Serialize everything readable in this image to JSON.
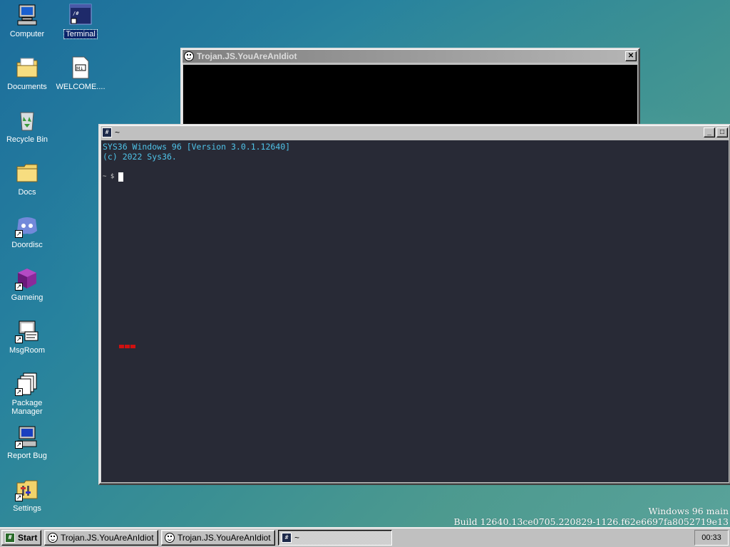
{
  "desktop": {
    "icons": [
      {
        "label": "Computer",
        "icon": "computer-icon"
      },
      {
        "label": "Terminal",
        "icon": "terminal-icon"
      },
      {
        "label": "Documents",
        "icon": "documents-folder-icon"
      },
      {
        "label": "WELCOME....",
        "icon": "markdown-file-icon"
      },
      {
        "label": "Recycle Bin",
        "icon": "recycle-bin-icon"
      },
      {
        "label": "Docs",
        "icon": "folder-icon"
      },
      {
        "label": "Doordisc",
        "icon": "discord-icon"
      },
      {
        "label": "Gameing",
        "icon": "game-cube-icon"
      },
      {
        "label": "MsgRoom",
        "icon": "msgroom-icon"
      },
      {
        "label": "Package Manager",
        "icon": "package-manager-icon"
      },
      {
        "label": "Report Bug",
        "icon": "report-bug-icon"
      },
      {
        "label": "Settings",
        "icon": "settings-icon"
      }
    ],
    "build_line1": "Windows 96 main",
    "build_line2": "Build 12640.13ce0705.220829-1126.f62e6697fa8052719e13"
  },
  "trojan_window": {
    "title": "Trojan.JS.YouAreAnIdiot",
    "close_glyph": "✕"
  },
  "terminal_window": {
    "title": "~",
    "line1": "SYS36 Windows 96 [Version 3.0.1.12640]",
    "line2": "(c) 2022 Sys36.",
    "prompt": "~ $",
    "minimize_glyph": "_",
    "maximize_glyph": "□"
  },
  "taskbar": {
    "start_label": "Start",
    "tasks": [
      {
        "label": "Trojan.JS.YouAreAnIdiot"
      },
      {
        "label": "Trojan.JS.YouAreAnIdiot"
      },
      {
        "label": "~"
      }
    ],
    "clock": "00:33"
  },
  "colors": {
    "terminal_bg": "#282a36",
    "terminal_text": "#4fc3e8",
    "taskbar": "#c0c0c0"
  }
}
